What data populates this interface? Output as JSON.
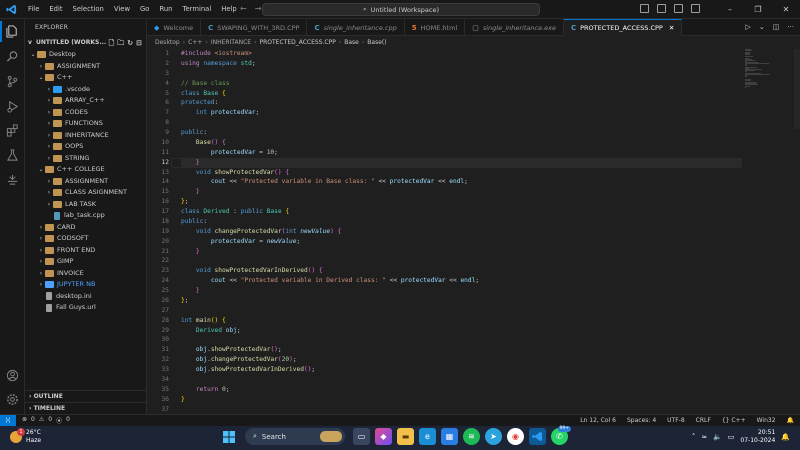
{
  "window": {
    "menu": [
      "File",
      "Edit",
      "Selection",
      "View",
      "Go",
      "Run",
      "Terminal",
      "Help"
    ],
    "search_text": "Untitled (Workspace)"
  },
  "sidebar": {
    "title": "EXPLORER",
    "workspace": "UNTITLED (WORKS...",
    "tree": [
      {
        "label": "Desktop",
        "indent": 0,
        "chev": "v",
        "kind": "root"
      },
      {
        "label": "ASSIGNMENT",
        "indent": 1,
        "chev": ">",
        "kind": "folder"
      },
      {
        "label": "C++",
        "indent": 1,
        "chev": "v",
        "kind": "folder"
      },
      {
        "label": ".vscode",
        "indent": 2,
        "chev": ">",
        "kind": "vscode"
      },
      {
        "label": "ARRAY_C++",
        "indent": 2,
        "chev": ">",
        "kind": "folder"
      },
      {
        "label": "CODES",
        "indent": 2,
        "chev": ">",
        "kind": "folder"
      },
      {
        "label": "FUNCTIONS",
        "indent": 2,
        "chev": ">",
        "kind": "folder"
      },
      {
        "label": "INHERITANCE",
        "indent": 2,
        "chev": ">",
        "kind": "folder"
      },
      {
        "label": "OOPS",
        "indent": 2,
        "chev": ">",
        "kind": "folder"
      },
      {
        "label": "STRING",
        "indent": 2,
        "chev": ">",
        "kind": "folder"
      },
      {
        "label": "C++ COLLEGE",
        "indent": 1,
        "chev": "v",
        "kind": "folder"
      },
      {
        "label": "ASSIGNMENT",
        "indent": 2,
        "chev": ">",
        "kind": "folder"
      },
      {
        "label": "CLASS ASIGNMENT",
        "indent": 2,
        "chev": ">",
        "kind": "folder"
      },
      {
        "label": "LAB TASK",
        "indent": 2,
        "chev": ">",
        "kind": "folder"
      },
      {
        "label": "lab_task.cpp",
        "indent": 2,
        "chev": "",
        "kind": "cpp"
      },
      {
        "label": "CARD",
        "indent": 1,
        "chev": ">",
        "kind": "folder"
      },
      {
        "label": "CODSOFT",
        "indent": 1,
        "chev": ">",
        "kind": "folder"
      },
      {
        "label": "FRONT END",
        "indent": 1,
        "chev": ">",
        "kind": "folder"
      },
      {
        "label": "GIMP",
        "indent": 1,
        "chev": ">",
        "kind": "folder"
      },
      {
        "label": "INVOICE",
        "indent": 1,
        "chev": ">",
        "kind": "folder"
      },
      {
        "label": "JUPYTER NB",
        "indent": 1,
        "chev": ">",
        "kind": "jupyter"
      },
      {
        "label": "desktop.ini",
        "indent": 1,
        "chev": "",
        "kind": "gear"
      },
      {
        "label": "Fall Guys.url",
        "indent": 1,
        "chev": "",
        "kind": "file"
      }
    ],
    "outline_label": "OUTLINE",
    "timeline_label": "TIMELINE"
  },
  "tabs": [
    {
      "label": "Welcome",
      "icon": "vscode",
      "active": false
    },
    {
      "label": "SWAPING_WITH_3RD.CPP",
      "icon": "cpp",
      "active": false
    },
    {
      "label": "single_inheritance.cpp",
      "icon": "cpp",
      "active": false
    },
    {
      "label": "HOME.html",
      "icon": "html",
      "active": false
    },
    {
      "label": "single_inheritance.exe",
      "icon": "exe",
      "active": false
    },
    {
      "label": "PROTECTED_ACCESS.CPP",
      "icon": "cpp",
      "active": true
    }
  ],
  "breadcrumb": [
    "Desktop",
    "C++",
    "INHERITANCE",
    "PROTECTED_ACCESS.CPP",
    "Base",
    "Base()"
  ],
  "editor": {
    "current_line": 12,
    "line_count": 37
  },
  "statusbar": {
    "errors": "0",
    "warnings": "0",
    "ports": "0",
    "position": "Ln 12, Col 6",
    "spaces": "Spaces: 4",
    "encoding": "UTF-8",
    "eol": "CRLF",
    "language": "C++",
    "platform": "Win32"
  },
  "taskbar": {
    "temperature": "26°C",
    "weather": "Haze",
    "weather_badge": "1",
    "search_label": "Search",
    "whatsapp_badge": "99+",
    "time": "20:51",
    "date": "07-10-2024"
  },
  "colors": {
    "accent": "#0078d4",
    "editor_bg": "#1f1f1f",
    "sidebar_bg": "#181818"
  }
}
